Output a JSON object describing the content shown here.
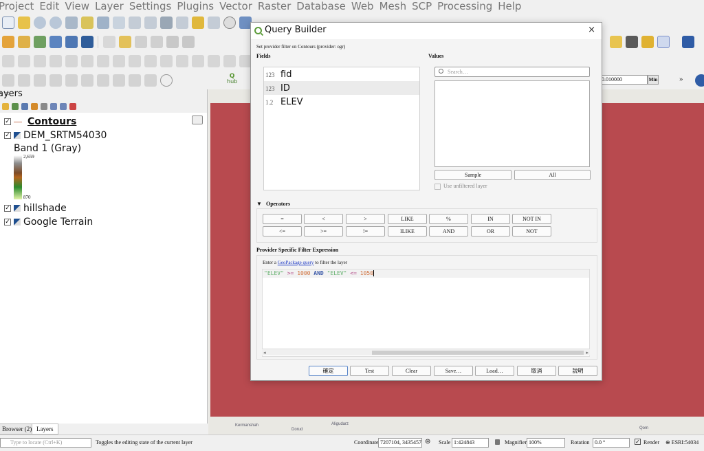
{
  "menu": [
    "Project",
    "Edit",
    "View",
    "Layer",
    "Settings",
    "Plugins",
    "Vector",
    "Raster",
    "Database",
    "Web",
    "Mesh",
    "SCP",
    "Processing",
    "Help"
  ],
  "toolbar": {
    "hub_label": "hub",
    "scale_field": "0.010000",
    "min_label": "Min",
    "more_label": "»"
  },
  "layers_panel": {
    "title": "ayers",
    "layers": [
      {
        "name": "Contours",
        "checked": "✓",
        "selected": true
      },
      {
        "name": "DEM_SRTM54030",
        "checked": "✓"
      },
      {
        "name": "hillshade",
        "checked": "✓"
      },
      {
        "name": "Google Terrain",
        "checked": "✓"
      }
    ],
    "band_label": "Band 1 (Gray)",
    "ramp_max": "2,659",
    "ramp_min": "870"
  },
  "bottom_tabs": [
    "Browser (2)",
    "Layers"
  ],
  "map": {
    "labels": [
      "Dorud",
      "Aligudarz",
      "Kermanshah",
      "Qom"
    ]
  },
  "status": {
    "locate_placeholder": "Type to locate (Ctrl+K)",
    "message": "Toggles the editing state of the current layer",
    "coordinate_label": "Coordinate",
    "coordinate_value": "7207104, 3435457",
    "scale_label": "Scale",
    "scale_value": "1:424843",
    "magnifier_label": "Magnifier",
    "magnifier_value": "100%",
    "rotation_label": "Rotation",
    "rotation_value": "0.0 °",
    "render_label": "Render",
    "crs": "ESRI:54034"
  },
  "dialog": {
    "title": "Query Builder",
    "close": "×",
    "subtitle": "Set provider filter on Contours (provider: ogr)",
    "fields_label": "Fields",
    "values_label": "Values",
    "fields": [
      {
        "type": "123",
        "name": "fid"
      },
      {
        "type": "123",
        "name": "ID"
      },
      {
        "type": "1.2",
        "name": "ELEV"
      }
    ],
    "search_placeholder": "Search…",
    "sample_button": "Sample",
    "all_button": "All",
    "use_unfiltered": "Use unfiltered layer",
    "operators_label": "Operators",
    "operators_row1": [
      "=",
      "<",
      ">",
      "LIKE",
      "%",
      "IN",
      "NOT IN"
    ],
    "operators_row2": [
      "<=",
      ">=",
      "!=",
      "ILIKE",
      "AND",
      "OR",
      "NOT"
    ],
    "expression_label": "Provider Specific Filter Expression",
    "hint_prefix": "Enter a ",
    "hint_link": "GeoPackage query",
    "hint_suffix": " to filter the layer",
    "expression": {
      "field1": "\"ELEV\"",
      "op1": ">=",
      "val1": "1000",
      "kw": "AND",
      "field2": "\"ELEV\"",
      "op2": "<=",
      "val2": "1050"
    },
    "buttons": [
      "確定",
      "Test",
      "Clear",
      "Save…",
      "Load…",
      "取消",
      "說明"
    ]
  }
}
